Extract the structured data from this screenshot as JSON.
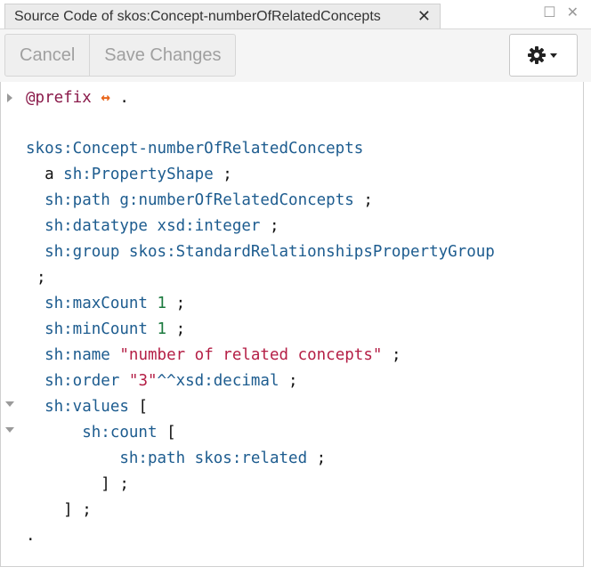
{
  "tab": {
    "title": "Source Code of skos:Concept-numberOfRelatedConcepts",
    "close": "✕"
  },
  "window": {
    "minimize": "☐",
    "close": "✕"
  },
  "toolbar": {
    "cancel_label": "Cancel",
    "save_label": "Save Changes",
    "settings_icon": "gear-icon"
  },
  "code": {
    "l1_prefix": "@prefix",
    "l1_arrow": "↔",
    "l1_dot": ".",
    "l3_subject": "skos:Concept-numberOfRelatedConcepts",
    "l4_a": "a",
    "l4_type": "sh:PropertyShape",
    "l4_end": ";",
    "l5_pred": "sh:path",
    "l5_obj": "g:numberOfRelatedConcepts",
    "l5_end": ";",
    "l6_pred": "sh:datatype",
    "l6_obj": "xsd:integer",
    "l6_end": ";",
    "l7_pred": "sh:group",
    "l7_obj": "skos:StandardRelationshipsPropertyGroup",
    "l8_end": ";",
    "l9_pred": "sh:maxCount",
    "l9_val": "1",
    "l9_end": ";",
    "l10_pred": "sh:minCount",
    "l10_val": "1",
    "l10_end": ";",
    "l11_pred": "sh:name",
    "l11_val": "\"number of related concepts\"",
    "l11_end": ";",
    "l12_pred": "sh:order",
    "l12_val": "\"3\"",
    "l12_type": "^^xsd:decimal",
    "l12_end": ";",
    "l13_pred": "sh:values",
    "l13_open": "[",
    "l14_pred": "sh:count",
    "l14_open": "[",
    "l15_pred": "sh:path",
    "l15_obj": "skos:related",
    "l15_end": ";",
    "l16": "] ;",
    "l17": "] ;",
    "l18": "."
  }
}
